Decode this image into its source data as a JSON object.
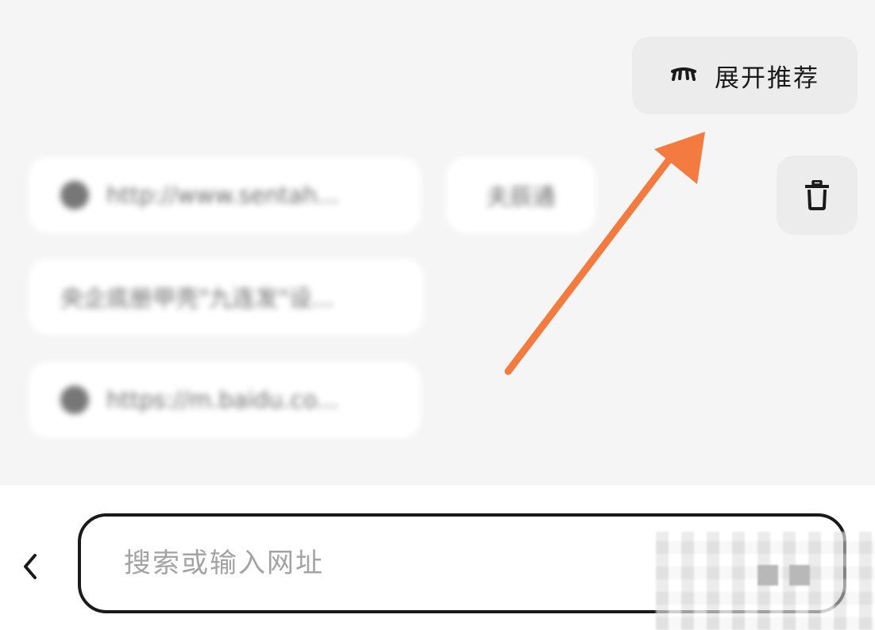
{
  "recommend": {
    "expand_label": "展开推荐",
    "icon": "closed-eye-icon"
  },
  "history": {
    "chips": [
      {
        "text": "http://www.sentah...",
        "has_icon": true
      },
      {
        "text": "夫辰通",
        "has_icon": false
      },
      {
        "text": "央企底册甲壳\"九连发\"设...",
        "has_icon": false
      },
      {
        "text": "https://m.baidu.co...",
        "has_icon": true
      }
    ],
    "clear_icon": "trash-icon"
  },
  "annotation": {
    "arrow_color": "#f47b3f"
  },
  "search": {
    "placeholder": "搜索或输入网址",
    "value": "",
    "back_icon": "chevron-left-icon"
  }
}
